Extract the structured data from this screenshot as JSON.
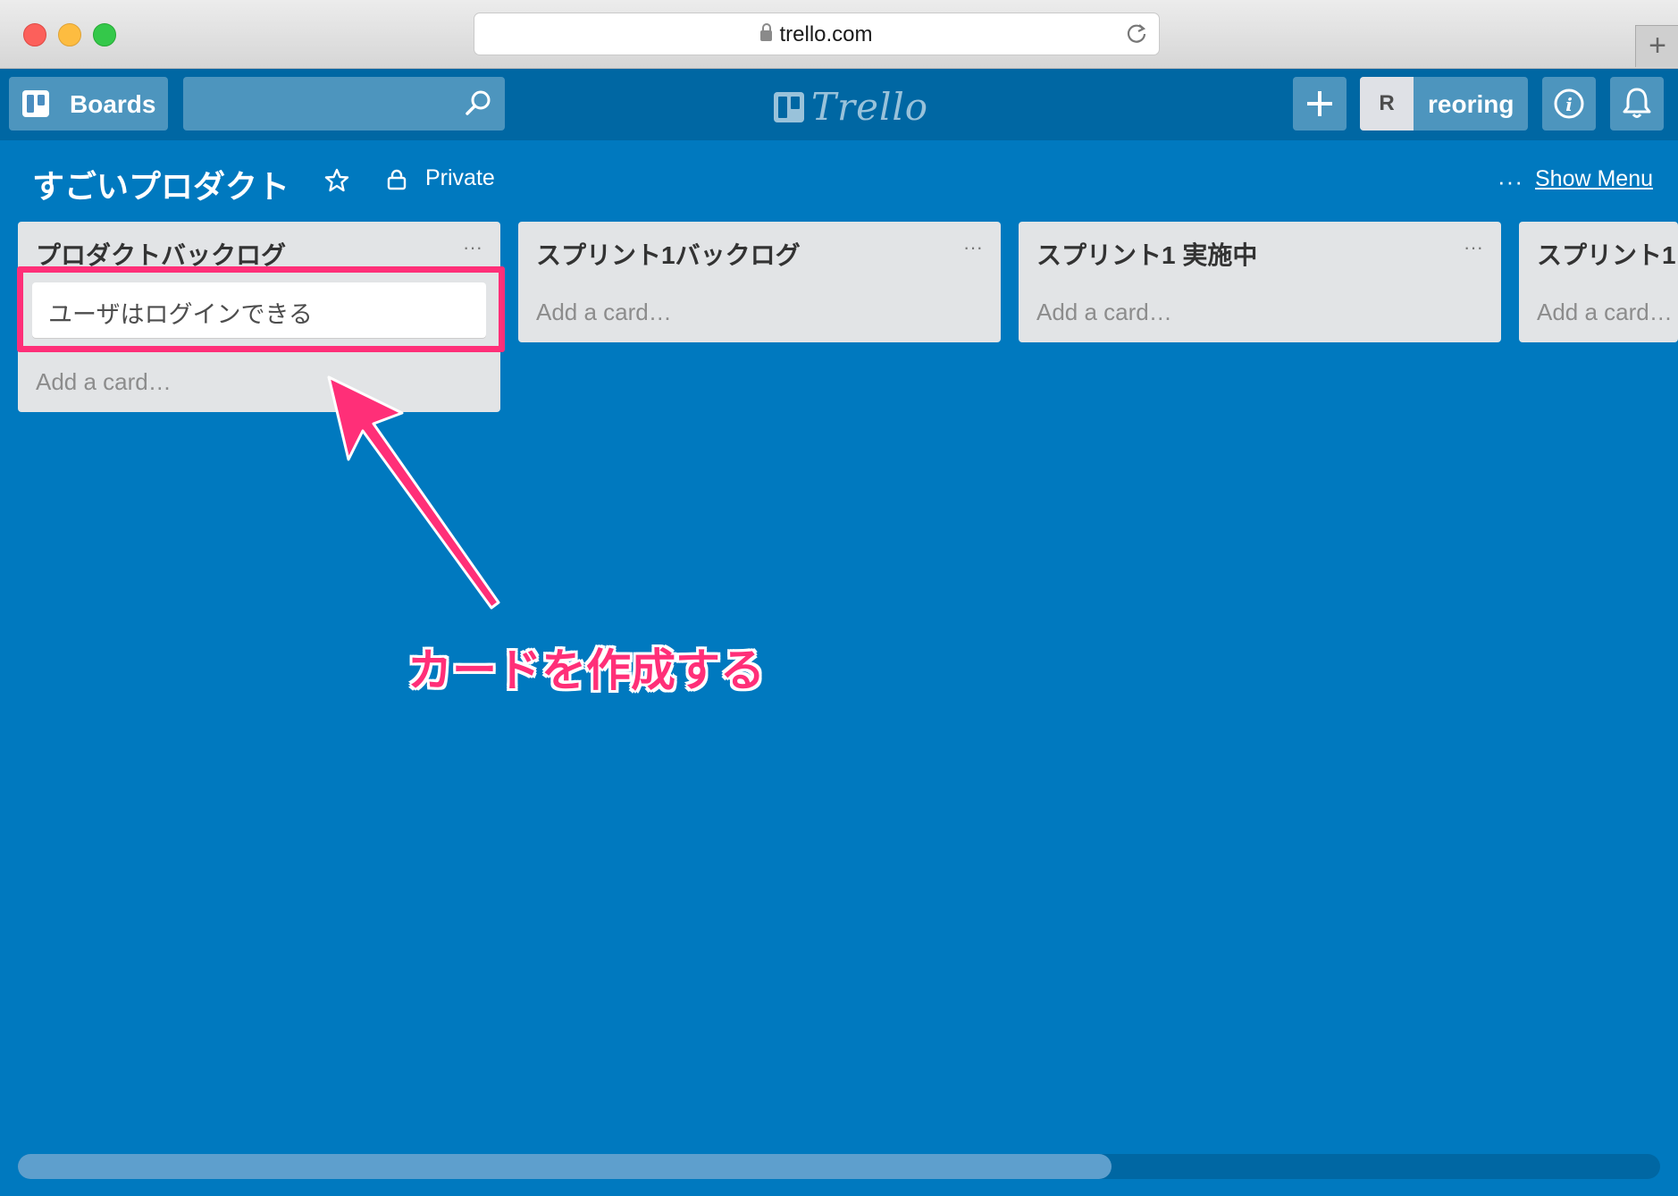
{
  "browser": {
    "url": "trello.com",
    "new_tab_icon": "plus-icon"
  },
  "header": {
    "boards_label": "Boards",
    "logo_text": "Trello",
    "user_initial": "R",
    "username": "reoring"
  },
  "board": {
    "title": "すごいプロダクト",
    "privacy_label": "Private",
    "menu_dots": "···",
    "show_menu_label": "Show Menu"
  },
  "lists": [
    {
      "title": "プロダクトバックログ",
      "dots": "···",
      "cards": [
        "ユーザはログインできる"
      ],
      "add_label": "Add a card…"
    },
    {
      "title": "スプリント1バックログ",
      "dots": "···",
      "cards": [],
      "add_label": "Add a card…"
    },
    {
      "title": "スプリント1 実施中",
      "dots": "···",
      "cards": [],
      "add_label": "Add a card…"
    },
    {
      "title": "スプリント1",
      "dots": "",
      "cards": [],
      "add_label": "Add a card…"
    }
  ],
  "annotation": {
    "callout_text": "カードを作成する",
    "color": "#ff2f78"
  },
  "colors": {
    "board_background": "#0079bf",
    "header_background": "#0067a3",
    "list_background": "#e2e4e6"
  }
}
